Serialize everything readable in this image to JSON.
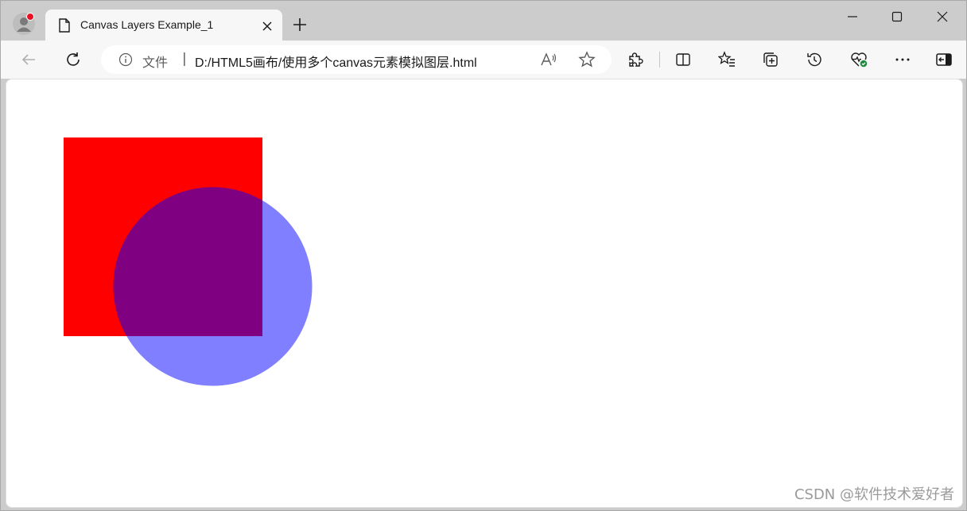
{
  "browser": {
    "tab": {
      "title": "Canvas Layers Example_1"
    },
    "address_bar": {
      "file_label": "文件",
      "separator": "|",
      "url": "D:/HTML5画布/使用多个canvas元素模拟图层.html"
    }
  },
  "canvas_layers": {
    "square": {
      "color": "#ff0000"
    },
    "circle": {
      "color": "#0000ff",
      "opacity": 0.5
    }
  },
  "watermark": "CSDN @软件技术爱好者",
  "colors": {
    "titlebar": "#cccccc",
    "toolbar": "#f7f7f7",
    "content": "#ffffff",
    "profile_badge": "#e81123",
    "health_badge": "#1d8c3a"
  },
  "icons": {
    "profile": "profile-avatar-icon",
    "tab": "page-document-icon",
    "tab_close": "close-icon",
    "new_tab": "plus-icon",
    "back": "back-arrow-icon",
    "refresh": "refresh-icon",
    "info": "info-icon",
    "read_aloud": "read-aloud-icon",
    "favorite": "star-icon",
    "extensions": "puzzle-icon",
    "split_screen": "split-screen-icon",
    "favorites": "favorites-list-icon",
    "collections": "collections-icon",
    "history": "history-icon",
    "browser_essentials": "heart-pulse-icon",
    "more": "more-dots-icon",
    "sidebar": "sidebar-icon"
  }
}
